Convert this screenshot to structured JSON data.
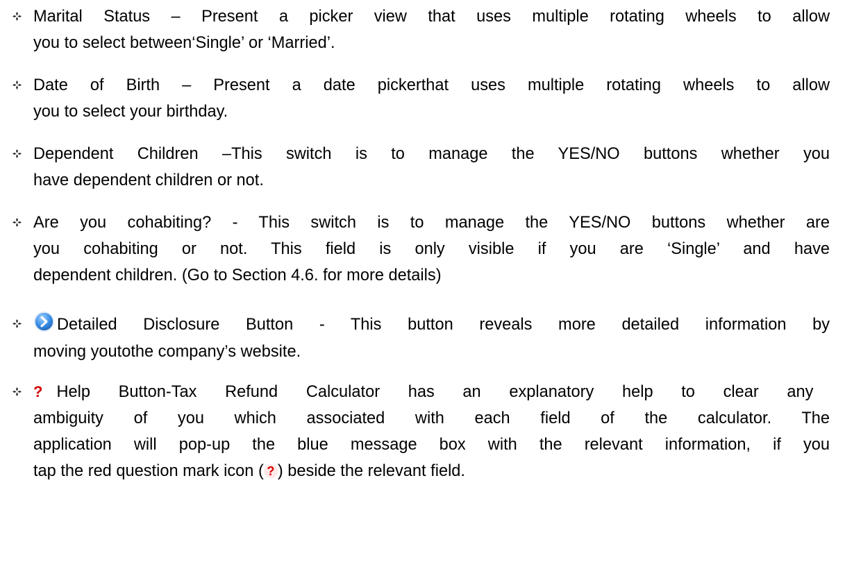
{
  "items": [
    {
      "lines": [
        "Marital Status – Present a picker view that uses multiple rotating wheels to allow",
        "you to select between‘Single’ or ‘Married’."
      ]
    },
    {
      "lines": [
        "Date of Birth – Present a date pickerthat uses multiple rotating wheels to allow",
        "you to select your birthday."
      ]
    },
    {
      "lines": [
        "Dependent Children –This switch is to manage the YES/NO buttons whether you",
        "have dependent children or not."
      ]
    },
    {
      "lines": [
        "Are you cohabiting? - This switch is to manage the YES/NO buttons whether are",
        "you cohabiting or not. This field is only visible if you are ‘Single’ and have",
        "dependent children. (Go to Section 4.6. for more details)"
      ]
    },
    {
      "icon": "detail-disclosure-icon",
      "lines": [
        "Detailed Disclosure Button - This button reveals more detailed information by",
        "moving youtothe company’s website."
      ]
    },
    {
      "icon": "help-question-icon",
      "lines": [
        "Help Button-Tax Refund Calculator has an explanatory help to clear any",
        "ambiguity of you which associated with each field of the calculator. The",
        "application will pop-up the blue message box with the relevant information, if you",
        "tap the red question mark icon (",
        ") beside the relevant field."
      ]
    }
  ],
  "icon_glyphs": {
    "help": "?"
  },
  "colors": {
    "bullet": "#222222",
    "disclosure": "#2f7fd6",
    "help": "#d40000"
  }
}
